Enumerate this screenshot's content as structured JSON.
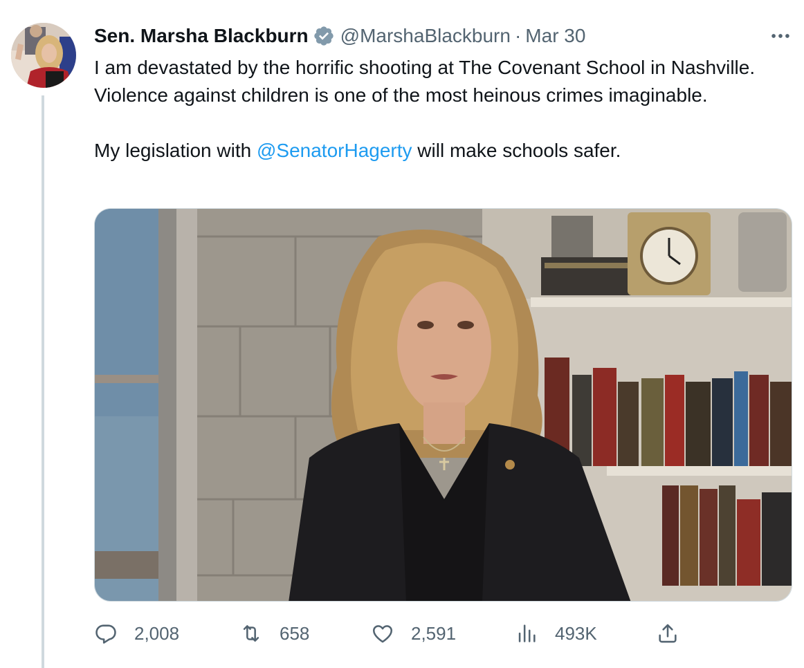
{
  "author": {
    "display_name": "Sen. Marsha Blackburn",
    "handle": "@MarshaBlackburn",
    "separator": "·",
    "date": "Mar 30",
    "verified_icon": "verified-badge-icon",
    "badge_color": "#829aab"
  },
  "tweet": {
    "paragraph1": "I am devastated by the horrific shooting at The Covenant School in Nashville. Violence against children is one of the most heinous crimes imaginable.",
    "paragraph2_before": "My legislation with ",
    "mention": "@SenatorHagerty",
    "paragraph2_after": " will make schools safer."
  },
  "media": {
    "type": "video-thumbnail"
  },
  "actions": {
    "replies": "2,008",
    "retweets": "658",
    "likes": "2,591",
    "views": "493K"
  },
  "colors": {
    "text": "#0f1419",
    "secondary": "#536471",
    "link": "#1d9bf0",
    "thread_line": "#cfd9de"
  },
  "icons": [
    "more-icon",
    "reply-icon",
    "retweet-icon",
    "like-icon",
    "views-icon",
    "share-icon"
  ]
}
